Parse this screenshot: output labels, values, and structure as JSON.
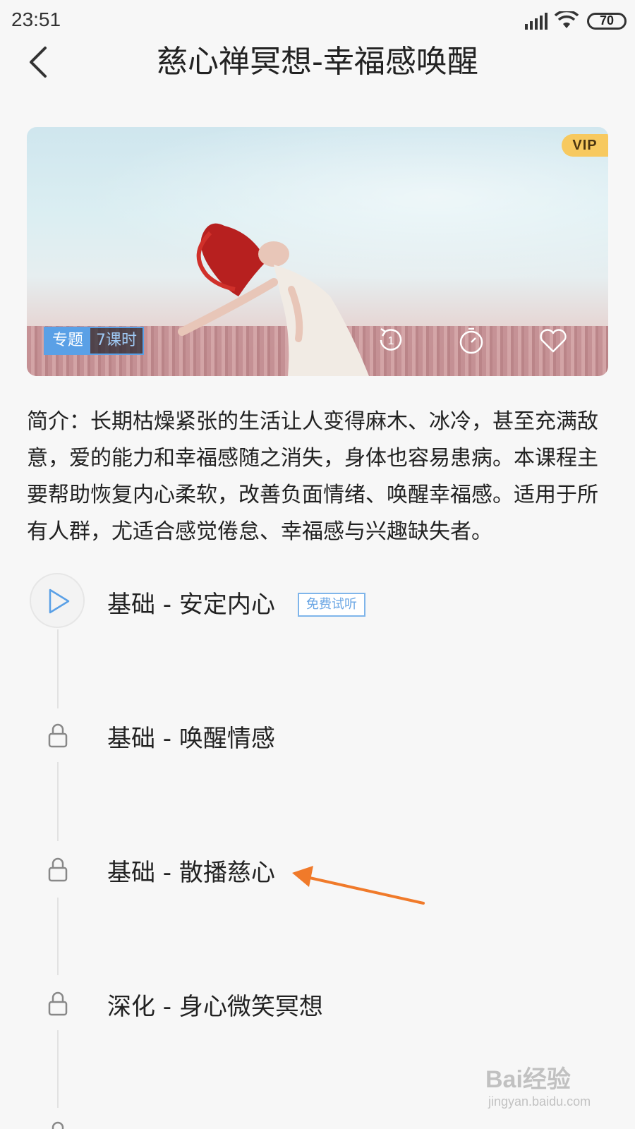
{
  "status_bar": {
    "time": "23:51",
    "battery": "70"
  },
  "header": {
    "title": "慈心禅冥想-幸福感唤醒"
  },
  "banner": {
    "vip_badge": "VIP",
    "tag_label": "专题",
    "tag_count": "7课时",
    "icons": [
      "replay-1-icon",
      "timer-icon",
      "heart-icon"
    ]
  },
  "description": "简介：长期枯燥紧张的生活让人变得麻木、冰冷，甚至充满敌意，爱的能力和幸福感随之消失，身体也容易患病。本课程主要帮助恢复内心柔软，改善负面情绪、唤醒幸福感。适用于所有人群，尤适合感觉倦怠、幸福感与兴趣缺失者。",
  "lessons": [
    {
      "title": "基础 - 安定内心",
      "badge": "免费试听",
      "locked": false
    },
    {
      "title": "基础 - 唤醒情感",
      "locked": true
    },
    {
      "title": "基础 - 散播慈心",
      "locked": true
    },
    {
      "title": "深化 - 身心微笑冥想",
      "locked": true
    }
  ],
  "watermark": {
    "logo": "Bai经验",
    "site": "jingyan.baidu.com"
  },
  "colors": {
    "accent_blue": "#5aa0e6",
    "vip_gold": "#f7c95f",
    "annotation_orange": "#f07a2a"
  }
}
